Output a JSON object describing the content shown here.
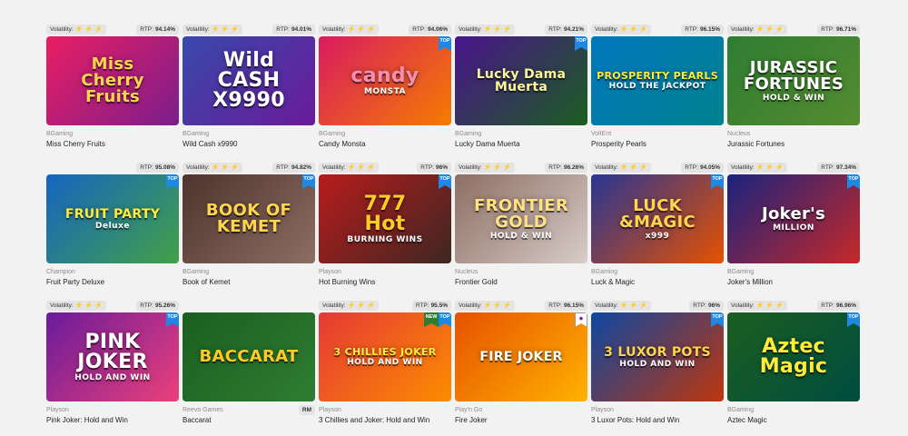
{
  "labels": {
    "volatility": "Volatility:",
    "rtp": "RTP:"
  },
  "games": [
    {
      "name": "Miss Cherry Fruits",
      "provider": "BGaming",
      "volatility": 3,
      "rtp": "94.14%",
      "badges": [],
      "art": "Miss\nCherry\nFruits",
      "art_sub": "",
      "colors": [
        "#e91e63",
        "#7b1e8c"
      ],
      "text_color": "#ffd54f"
    },
    {
      "name": "Wild Cash x9990",
      "provider": "BGaming",
      "volatility": 3,
      "rtp": "94.01%",
      "badges": [],
      "art": "Wild\nCASH\nX9990",
      "art_sub": "",
      "colors": [
        "#3949ab",
        "#6a1b9a"
      ],
      "text_color": "#ffffff"
    },
    {
      "name": "Candy Monsta",
      "provider": "BGaming",
      "volatility": 3,
      "rtp": "94.06%",
      "badges": [
        "TOP"
      ],
      "art": "candy",
      "art_sub": "MONSTA",
      "colors": [
        "#d81b60",
        "#f57c00"
      ],
      "text_color": "#f48fb1"
    },
    {
      "name": "Lucky Dama Muerta",
      "provider": "BGaming",
      "volatility": 3,
      "rtp": "94.21%",
      "badges": [
        "TOP"
      ],
      "art": "Lucky Dama\nMuerta",
      "art_sub": "",
      "colors": [
        "#4a148c",
        "#1b5e20"
      ],
      "text_color": "#fff59d"
    },
    {
      "name": "Prosperity Pearls",
      "provider": "VoltEnt",
      "volatility": 3,
      "rtp": "96.15%",
      "badges": [],
      "art": "PROSPERITY PEARLS",
      "art_sub": "HOLD THE JACKPOT",
      "colors": [
        "#0277bd",
        "#00838f"
      ],
      "text_color": "#ffeb3b"
    },
    {
      "name": "Jurassic Fortunes",
      "provider": "Nucleus",
      "volatility": 3,
      "rtp": "96.71%",
      "badges": [],
      "art": "JURASSIC\nFORTUNES",
      "art_sub": "HOLD & WIN",
      "colors": [
        "#2e7d32",
        "#558b2f"
      ],
      "text_color": "#ffffff"
    },
    {
      "name": "Fruit Party Deluxe",
      "provider": "Champion",
      "volatility": 0,
      "rtp": "95.08%",
      "badges": [
        "TOP"
      ],
      "art": "FRUIT PARTY",
      "art_sub": "Deluxe",
      "colors": [
        "#1565c0",
        "#43a047"
      ],
      "text_color": "#ffeb3b"
    },
    {
      "name": "Book of Kemet",
      "provider": "BGaming",
      "volatility": 3,
      "rtp": "94.82%",
      "badges": [
        "TOP"
      ],
      "art": "BOOK OF\nKEMET",
      "art_sub": "",
      "colors": [
        "#4e342e",
        "#8d6e63"
      ],
      "text_color": "#ffd54f"
    },
    {
      "name": "Hot Burning Wins",
      "provider": "Playson",
      "volatility": 3,
      "rtp": "96%",
      "badges": [
        "TOP"
      ],
      "art": "777\nHot",
      "art_sub": "BURNING WINS",
      "colors": [
        "#b71c1c",
        "#3e2723"
      ],
      "text_color": "#ffca28"
    },
    {
      "name": "Frontier Gold",
      "provider": "Nucleus",
      "volatility": 3,
      "rtp": "96.26%",
      "badges": [],
      "art": "FRONTIER\nGOLD",
      "art_sub": "HOLD & WIN",
      "colors": [
        "#8d6e63",
        "#d7ccc8"
      ],
      "text_color": "#ffe082"
    },
    {
      "name": "Luck & Magic",
      "provider": "BGaming",
      "volatility": 3,
      "rtp": "94.05%",
      "badges": [
        "TOP"
      ],
      "art": "LUCK\n&MAGIC",
      "art_sub": "x999",
      "colors": [
        "#283593",
        "#e65100"
      ],
      "text_color": "#ffd54f"
    },
    {
      "name": "Joker's Million",
      "provider": "BGaming",
      "volatility": 3,
      "rtp": "97.34%",
      "badges": [
        "TOP"
      ],
      "art": "Joker's",
      "art_sub": "MILLION",
      "colors": [
        "#1a237e",
        "#c62828"
      ],
      "text_color": "#ffffff"
    },
    {
      "name": "Pink Joker: Hold and Win",
      "provider": "Playson",
      "volatility": 3,
      "rtp": "95.26%",
      "badges": [
        "TOP"
      ],
      "art": "PINK\nJOKER",
      "art_sub": "HOLD AND WIN",
      "colors": [
        "#6a1b9a",
        "#ec407a"
      ],
      "text_color": "#ffffff"
    },
    {
      "name": "Baccarat",
      "provider": "Reevo Games",
      "volatility": null,
      "rtp": "",
      "badges": [],
      "rm": "RM",
      "art": "BACCARAT",
      "art_sub": "",
      "colors": [
        "#1b5e20",
        "#2e7d32"
      ],
      "text_color": "#ffca28"
    },
    {
      "name": "3 Chillies and Joker: Hold and Win",
      "provider": "Playson",
      "volatility": 3,
      "rtp": "95.5%",
      "badges": [
        "NEW",
        "TOP"
      ],
      "art": "3 CHILLIES JOKER",
      "art_sub": "HOLD AND WIN",
      "colors": [
        "#e53935",
        "#fb8c00"
      ],
      "text_color": "#ffeb3b"
    },
    {
      "name": "Fire Joker",
      "provider": "Play'n Go",
      "volatility": 3,
      "rtp": "96.15%",
      "badges": [
        "GEM"
      ],
      "art": "FIRE JOKER",
      "art_sub": "",
      "colors": [
        "#e65100",
        "#ffb300"
      ],
      "text_color": "#ffffff"
    },
    {
      "name": "3 Luxor Pots: Hold and Win",
      "provider": "Playson",
      "volatility": 3,
      "rtp": "96%",
      "badges": [
        "TOP"
      ],
      "art": "3 LUXOR POTS",
      "art_sub": "HOLD AND WIN",
      "colors": [
        "#0d47a1",
        "#bf360c"
      ],
      "text_color": "#ffd54f"
    },
    {
      "name": "Aztec Magic",
      "provider": "BGaming",
      "volatility": 3,
      "rtp": "96.96%",
      "badges": [
        "TOP"
      ],
      "art": "Aztec\nMagic",
      "art_sub": "",
      "colors": [
        "#1b5e20",
        "#004d40"
      ],
      "text_color": "#ffeb3b"
    }
  ]
}
